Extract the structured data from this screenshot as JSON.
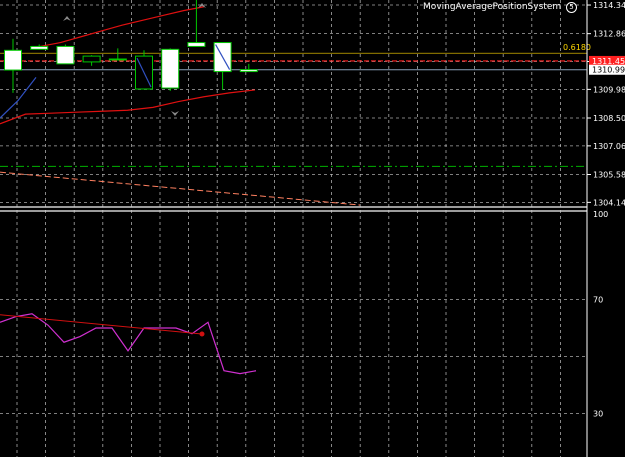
{
  "window": {
    "indicator_name": "MovingAveragePositionSystem",
    "indicator_badge": "5"
  },
  "colors": {
    "background": "#000000",
    "grid": "#c8c8c8",
    "axis": "#ffffff",
    "bull_candle": "#ffffff",
    "bear_candle": "#000000",
    "wick": "#00c800",
    "bollinger": "#e01010",
    "fib_level": "#ffd700",
    "current_price": "#ff2020",
    "bid_line": "#8aa0b8",
    "green_level": "#00b000",
    "trend_line": "#ff8060",
    "rsi": "#d030d0",
    "rsi_trend": "#d01010",
    "arrow": "#8a8a8a"
  },
  "chart_data": [
    {
      "type": "candlestick",
      "y_ticks": [
        "1314.340",
        "1312.860",
        "1311.420",
        "1309.980",
        "1308.500",
        "1307.060",
        "1305.580",
        "1304.140"
      ],
      "ylim": [
        1303.9,
        1314.6
      ],
      "fib_label": "0.6180",
      "fib_price": 1311.85,
      "current_price_label": "1311.455",
      "current_price": 1311.45,
      "bid_price_label": "1310.995",
      "bid_price": 1310.995,
      "green_level": 1306.0,
      "grid": true,
      "candles": [
        {
          "open": 1310.98,
          "high": 1312.6,
          "low": 1309.8,
          "close": 1312.0
        },
        {
          "open": 1312.05,
          "high": 1312.3,
          "low": 1312.05,
          "close": 1312.2
        },
        {
          "open": 1311.3,
          "high": 1312.3,
          "low": 1311.3,
          "close": 1312.2
        },
        {
          "open": 1311.7,
          "high": 1311.75,
          "low": 1311.2,
          "close": 1311.4
        },
        {
          "open": 1311.55,
          "high": 1312.1,
          "low": 1311.5,
          "close": 1311.55
        },
        {
          "open": 1311.7,
          "high": 1312.0,
          "low": 1310.0,
          "close": 1310.0
        },
        {
          "open": 1310.05,
          "high": 1312.1,
          "low": 1309.9,
          "close": 1312.05
        },
        {
          "open": 1312.2,
          "high": 1314.6,
          "low": 1312.2,
          "close": 1312.4
        },
        {
          "open": 1310.9,
          "high": 1312.4,
          "low": 1309.95,
          "close": 1312.4
        },
        {
          "open": 1310.9,
          "high": 1311.3,
          "low": 1310.9,
          "close": 1311.0
        }
      ],
      "bollinger_upper": [
        1312.2,
        1312.4,
        1312.7,
        1313.0,
        1313.3,
        1313.55,
        1313.8,
        1314.05,
        1314.25
      ],
      "bollinger_lower": [
        1308.2,
        1308.7,
        1308.75,
        1308.8,
        1308.85,
        1308.9,
        1309.05,
        1309.35,
        1309.6,
        1309.8,
        1309.95
      ],
      "blue_ma": [
        1308.5,
        1309.4,
        1310.6
      ],
      "trend_line": [
        1305.7,
        1304.0
      ]
    },
    {
      "type": "line",
      "y_ticks": [
        "100",
        "70",
        "30"
      ],
      "ylim": [
        0,
        100
      ],
      "rsi_values": [
        62,
        64,
        65,
        61,
        55,
        57,
        60,
        60,
        52,
        60,
        60,
        60,
        58,
        62,
        45,
        44,
        45
      ],
      "rsi_trend": [
        65,
        60
      ],
      "grid": true
    }
  ]
}
